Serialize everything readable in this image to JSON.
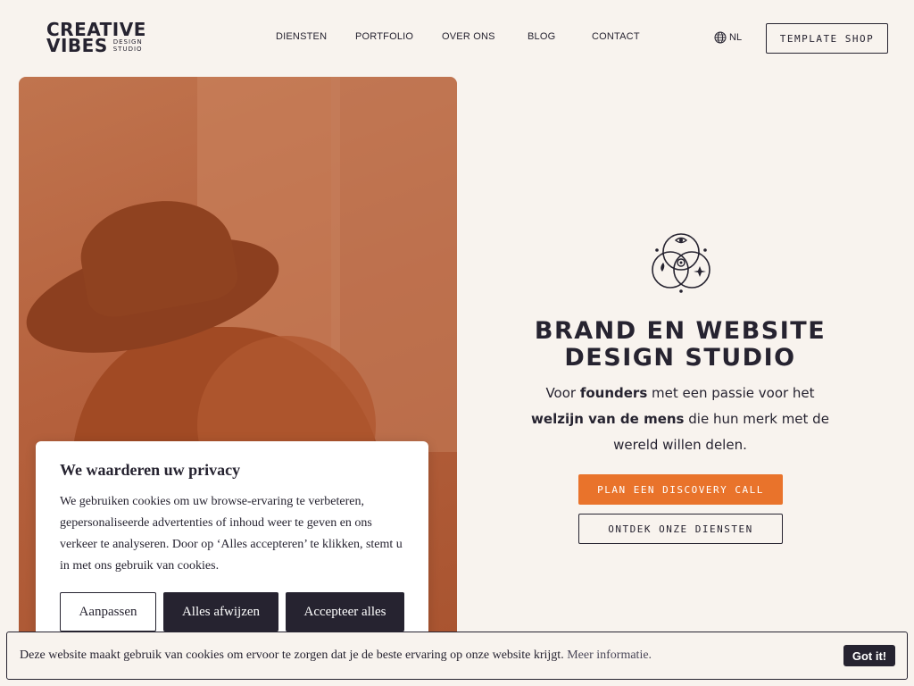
{
  "header": {
    "logo": {
      "line1": "CREATIVE",
      "line2": "VIBES",
      "tag1": "DESIGN",
      "tag2": "STUDIO"
    },
    "nav": [
      "DIENSTEN",
      "PORTFOLIO",
      "OVER ONS",
      "BLOG",
      "CONTACT"
    ],
    "language": "NL",
    "shop_label": "TEMPLATE SHOP"
  },
  "hero": {
    "title_line1": "BRAND EN WEBSITE",
    "title_line2": "DESIGN STUDIO",
    "subtitle_parts": [
      "Voor ",
      "founders",
      " met een passie voor het ",
      "welzijn van de mens",
      " die hun merk met de wereld willen delen."
    ],
    "primary_cta": "PLAN EEN DISCOVERY CALL",
    "secondary_cta": "ONTDEK ONZE DIENSTEN"
  },
  "privacy_modal": {
    "title": "We waarderen uw privacy",
    "body": "We gebruiken cookies om uw browse-ervaring te verbeteren, gepersonaliseerde advertenties of inhoud weer te geven en ons verkeer te analyseren. Door op ‘Alles accepteren’ te klikken, stemt u in met ons gebruik van cookies.",
    "customize_label": "Aanpassen",
    "reject_label": "Alles afwijzen",
    "accept_label": "Accepteer alles"
  },
  "cookie_bar": {
    "text": "Deze website maakt gebruik van cookies om ervoor te zorgen dat je de beste ervaring op onze website krijgt.",
    "more_link": "Meer informatie.",
    "button_label": "Got it!"
  },
  "colors": {
    "background": "#f8f3ee",
    "ink": "#262330",
    "accent": "#e9732b",
    "hero_photo_tint": "#b5613d"
  },
  "icons": [
    "globe-icon",
    "emblem-icon"
  ]
}
